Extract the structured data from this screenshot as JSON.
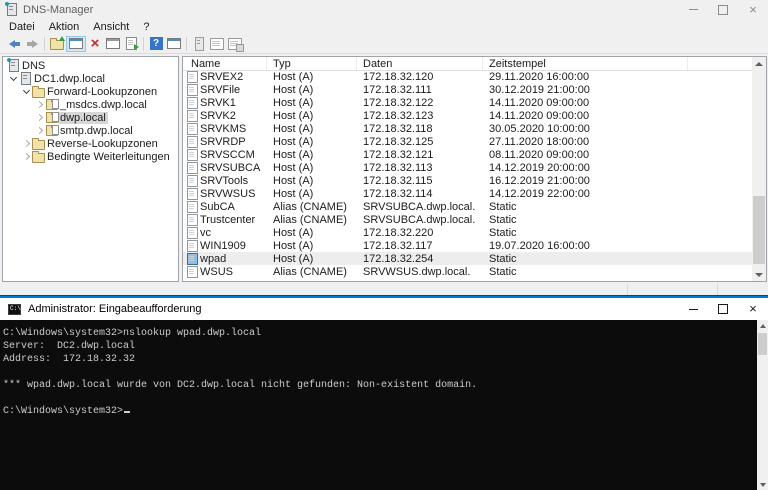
{
  "colors": {
    "accent": "#0078d7",
    "console_bg": "#0c0c0c",
    "console_text": "#cccccc",
    "selection_gray": "#d6d6d6"
  },
  "dns_window": {
    "title": "DNS-Manager",
    "menu": [
      "Datei",
      "Aktion",
      "Ansicht",
      "?"
    ],
    "tree": [
      {
        "label": "DNS",
        "icon": "server-badge",
        "chevron": "none",
        "level": 0,
        "selected": false
      },
      {
        "label": "DC1.dwp.local",
        "icon": "server",
        "chevron": "expanded",
        "level": 0,
        "selected": false
      },
      {
        "label": "Forward-Lookupzonen",
        "icon": "folder",
        "chevron": "expanded",
        "level": 1,
        "selected": false
      },
      {
        "label": "_msdcs.dwp.local",
        "icon": "zone",
        "chevron": "collapsed",
        "level": 2,
        "selected": false
      },
      {
        "label": "dwp.local",
        "icon": "zone",
        "chevron": "collapsed",
        "level": 2,
        "selected": true
      },
      {
        "label": "smtp.dwp.local",
        "icon": "zone",
        "chevron": "collapsed",
        "level": 2,
        "selected": false
      },
      {
        "label": "Reverse-Lookupzonen",
        "icon": "folder",
        "chevron": "collapsed",
        "level": 1,
        "selected": false
      },
      {
        "label": "Bedingte Weiterleitungen",
        "icon": "folder",
        "chevron": "collapsed",
        "level": 1,
        "selected": false
      }
    ],
    "list": {
      "columns": [
        "Name",
        "Typ",
        "Daten",
        "Zeitstempel"
      ],
      "rows": [
        {
          "name": "SRVEX2",
          "type": "Host (A)",
          "data": "172.18.32.120",
          "timestamp": "29.11.2020 16:00:00",
          "selected": false
        },
        {
          "name": "SRVFile",
          "type": "Host (A)",
          "data": "172.18.32.111",
          "timestamp": "30.12.2019 21:00:00",
          "selected": false
        },
        {
          "name": "SRVK1",
          "type": "Host (A)",
          "data": "172.18.32.122",
          "timestamp": "14.11.2020 09:00:00",
          "selected": false
        },
        {
          "name": "SRVK2",
          "type": "Host (A)",
          "data": "172.18.32.123",
          "timestamp": "14.11.2020 09:00:00",
          "selected": false
        },
        {
          "name": "SRVKMS",
          "type": "Host (A)",
          "data": "172.18.32.118",
          "timestamp": "30.05.2020 10:00:00",
          "selected": false
        },
        {
          "name": "SRVRDP",
          "type": "Host (A)",
          "data": "172.18.32.125",
          "timestamp": "27.11.2020 18:00:00",
          "selected": false
        },
        {
          "name": "SRVSCCM",
          "type": "Host (A)",
          "data": "172.18.32.121",
          "timestamp": "08.11.2020 09:00:00",
          "selected": false
        },
        {
          "name": "SRVSUBCA",
          "type": "Host (A)",
          "data": "172.18.32.113",
          "timestamp": "14.12.2019 20:00:00",
          "selected": false
        },
        {
          "name": "SRVTools",
          "type": "Host (A)",
          "data": "172.18.32.115",
          "timestamp": "16.12.2019 21:00:00",
          "selected": false
        },
        {
          "name": "SRVWSUS",
          "type": "Host (A)",
          "data": "172.18.32.114",
          "timestamp": "14.12.2019 22:00:00",
          "selected": false
        },
        {
          "name": "SubCA",
          "type": "Alias (CNAME)",
          "data": "SRVSUBCA.dwp.local.",
          "timestamp": "Static",
          "selected": false
        },
        {
          "name": "Trustcenter",
          "type": "Alias (CNAME)",
          "data": "SRVSUBCA.dwp.local.",
          "timestamp": "Static",
          "selected": false
        },
        {
          "name": "vc",
          "type": "Host (A)",
          "data": "172.18.32.220",
          "timestamp": "Static",
          "selected": false
        },
        {
          "name": "WIN1909",
          "type": "Host (A)",
          "data": "172.18.32.117",
          "timestamp": "19.07.2020 16:00:00",
          "selected": false
        },
        {
          "name": "wpad",
          "type": "Host (A)",
          "data": "172.18.32.254",
          "timestamp": "Static",
          "selected": true
        },
        {
          "name": "WSUS",
          "type": "Alias (CNAME)",
          "data": "SRVWSUS.dwp.local.",
          "timestamp": "Static",
          "selected": false
        }
      ]
    }
  },
  "cmd_window": {
    "title": "Administrator: Eingabeaufforderung",
    "icon_label": "C:\\",
    "cursor_line": 6,
    "lines": [
      "C:\\Windows\\system32>nslookup wpad.dwp.local",
      "Server:  DC2.dwp.local",
      "Address:  172.18.32.32",
      "",
      "*** wpad.dwp.local wurde von DC2.dwp.local nicht gefunden: Non-existent domain.",
      "",
      "C:\\Windows\\system32>"
    ]
  }
}
